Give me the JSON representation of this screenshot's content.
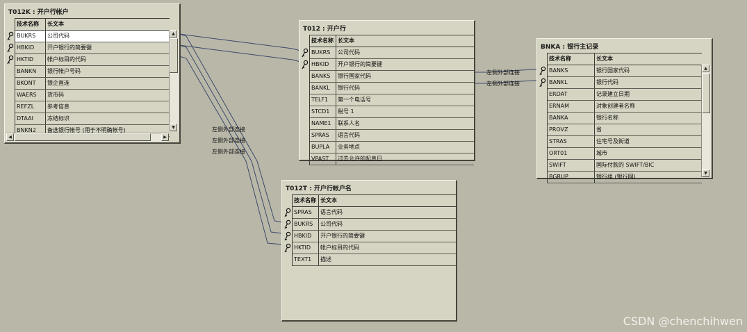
{
  "tables": {
    "t012k": {
      "title": "T012K : 开户行帐户",
      "col1": "技术名称",
      "col2": "长文本",
      "rows": [
        {
          "name": "BUKRS",
          "text": "公司代码",
          "key": true
        },
        {
          "name": "HBKID",
          "text": "开户银行的简要键",
          "key": true
        },
        {
          "name": "HKTID",
          "text": "帐户标目的代码",
          "key": true
        },
        {
          "name": "BANKN",
          "text": "银行帐户号码",
          "key": false
        },
        {
          "name": "BKONT",
          "text": "银企直连",
          "key": false
        },
        {
          "name": "WAERS",
          "text": "货币码",
          "key": false
        },
        {
          "name": "REFZL",
          "text": "参考信息",
          "key": false
        },
        {
          "name": "DTAAI",
          "text": "冻结标识",
          "key": false
        },
        {
          "name": "BNKN2",
          "text": "备选银行帐号 (用于不明确帐号)",
          "key": false
        }
      ]
    },
    "t012": {
      "title": "T012 : 开户行",
      "col1": "技术名称",
      "col2": "长文本",
      "rows": [
        {
          "name": "BUKRS",
          "text": "公司代码",
          "key": true
        },
        {
          "name": "HBKID",
          "text": "开户银行的简要键",
          "key": true
        },
        {
          "name": "BANKS",
          "text": "银行国家代码",
          "key": false
        },
        {
          "name": "BANKL",
          "text": "银行代码",
          "key": false
        },
        {
          "name": "TELF1",
          "text": "第一个电话号",
          "key": false
        },
        {
          "name": "STCD1",
          "text": "税号 1",
          "key": false
        },
        {
          "name": "NAME1",
          "text": "联系人名",
          "key": false
        },
        {
          "name": "SPRAS",
          "text": "语言代码",
          "key": false
        },
        {
          "name": "BUPLA",
          "text": "业务地点",
          "key": false
        },
        {
          "name": "VPAST",
          "text": "过去允许的起息日",
          "key": false
        }
      ]
    },
    "bnka": {
      "title": "BNKA : 银行主记录",
      "col1": "技术名称",
      "col2": "长文本",
      "rows": [
        {
          "name": "BANKS",
          "text": "银行国家代码",
          "key": true
        },
        {
          "name": "BANKL",
          "text": "银行代码",
          "key": true
        },
        {
          "name": "ERDAT",
          "text": "记录建立日期",
          "key": false
        },
        {
          "name": "ERNAM",
          "text": "对象创建者名称",
          "key": false
        },
        {
          "name": "BANKA",
          "text": "银行名称",
          "key": false
        },
        {
          "name": "PROVZ",
          "text": "省",
          "key": false
        },
        {
          "name": "STRAS",
          "text": "住宅号及街道",
          "key": false
        },
        {
          "name": "ORT01",
          "text": "城市",
          "key": false
        },
        {
          "name": "SWIFT",
          "text": "国际付款的 SWIFT/BIC",
          "key": false
        },
        {
          "name": "BGRUP",
          "text": "银行组 (银行网)",
          "key": false
        }
      ]
    },
    "t012t": {
      "title": "T012T : 开户行帐户名",
      "col1": "技术名称",
      "col2": "长文本",
      "rows": [
        {
          "name": "SPRAS",
          "text": "语言代码",
          "key": true
        },
        {
          "name": "BUKRS",
          "text": "公司代码",
          "key": true
        },
        {
          "name": "HBKID",
          "text": "开户银行的简要键",
          "key": true
        },
        {
          "name": "HKTID",
          "text": "帐户标目的代码",
          "key": true
        },
        {
          "name": "TEXT1",
          "text": "描述",
          "key": false
        }
      ]
    }
  },
  "relations": {
    "t012k_t012t_1": "左侧外部连接",
    "t012k_t012t_2": "左侧外部连接",
    "t012k_t012t_3": "左侧外部连接",
    "t012_bnka_1": "左侧外部连接",
    "t012_bnka_2": "左侧外部连接"
  },
  "watermark": "CSDN @chenchihwen",
  "colors": {
    "background": "#b9b7a8",
    "window": "#d6d4c2",
    "line": "#3a4a6a"
  }
}
